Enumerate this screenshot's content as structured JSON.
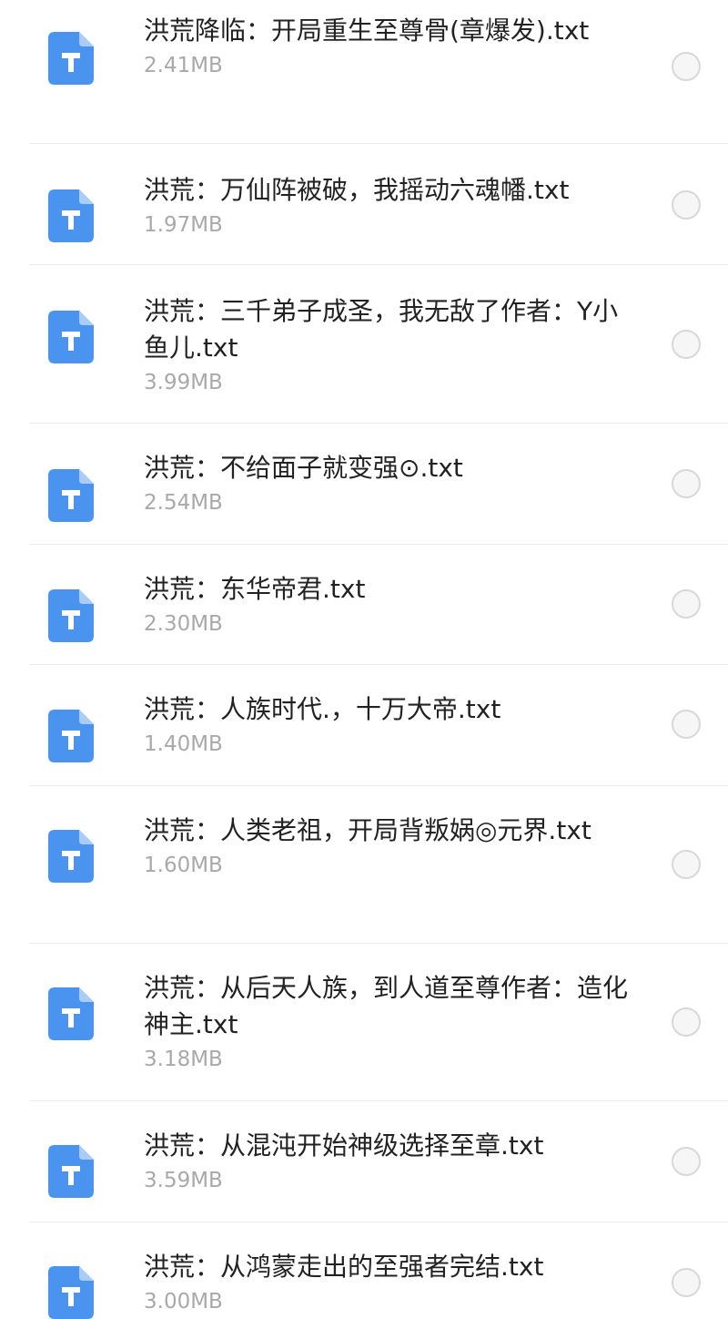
{
  "files": [
    {
      "name": "洪荒降临：开局重生至尊骨(章爆发).txt",
      "size": "2.41MB",
      "icon": "txt-file-icon"
    },
    {
      "name": "洪荒：万仙阵被破，我摇动六魂幡.txt",
      "size": "1.97MB",
      "icon": "txt-file-icon"
    },
    {
      "name": "洪荒：三千弟子成圣，我无敌了作者：Y小鱼儿.txt",
      "size": "3.99MB",
      "icon": "txt-file-icon"
    },
    {
      "name": "洪荒：不给面子就变强⊙.txt",
      "size": "2.54MB",
      "icon": "txt-file-icon"
    },
    {
      "name": "洪荒：东华帝君.txt",
      "size": "2.30MB",
      "icon": "txt-file-icon"
    },
    {
      "name": "洪荒：人族时代.，十万大帝.txt",
      "size": "1.40MB",
      "icon": "txt-file-icon"
    },
    {
      "name": "洪荒：人类老祖，开局背叛娲◎元界.txt",
      "size": "1.60MB",
      "icon": "txt-file-icon"
    },
    {
      "name": "洪荒：从后天人族，到人道至尊作者：造化神主.txt",
      "size": "3.18MB",
      "icon": "txt-file-icon"
    },
    {
      "name": "洪荒：从混沌开始神级选择至章.txt",
      "size": "3.59MB",
      "icon": "txt-file-icon"
    },
    {
      "name": "洪荒：从鸿蒙走出的至强者完结.txt",
      "size": "3.00MB",
      "icon": "txt-file-icon"
    }
  ],
  "colors": {
    "icon_blue": "#4a94f0",
    "icon_fold": "#a9cdf8",
    "size_text": "#a9a9a9",
    "divider": "#ececec"
  }
}
